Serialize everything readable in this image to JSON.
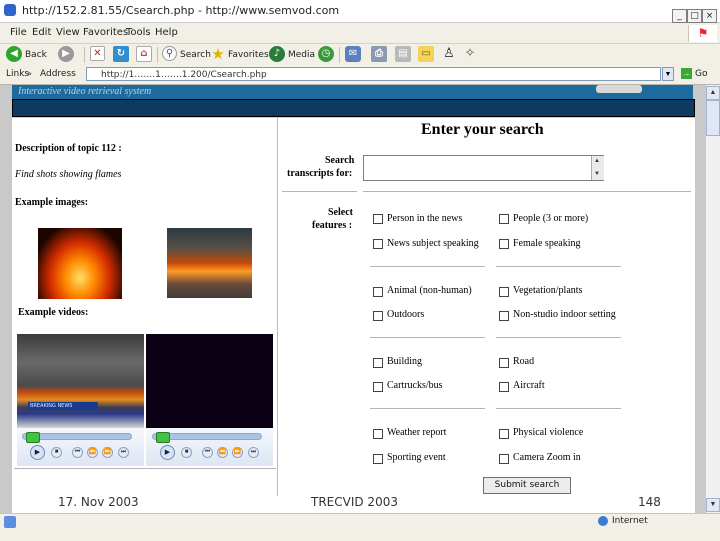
{
  "window": {
    "title": "http://152.2.81.55/Csearch.php - http://www.semvod.com",
    "buttons": [
      "_",
      "□",
      "×"
    ]
  },
  "menu": [
    "File",
    "Edit",
    "View",
    "Favorites",
    "Tools",
    "Help"
  ],
  "toolbar": {
    "back": "Back",
    "search": "Search",
    "favorites": "Favorites",
    "media": "Media"
  },
  "address": {
    "links_label": "Links",
    "address_label": "Address",
    "url": "http://1…….1…….1.200/Csearch.php",
    "go_label": "Go"
  },
  "page": {
    "banner_text": "Interactive video retrieval system",
    "left": {
      "description_heading": "Description of topic 112 :",
      "topic_text": "Find shots showing flames",
      "example_images_label": "Example images:",
      "example_videos_label": "Example videos:",
      "video_caption": "BREAKING NEWS"
    },
    "right": {
      "heading": "Enter your search",
      "search_label_line1": "Search",
      "search_label_line2": "transcripts for:",
      "features_label_line1": "Select",
      "features_label_line2": "features :",
      "feature_groups": [
        [
          "Person in the news",
          "People (3 or more)",
          "News subject speaking",
          "Female speaking"
        ],
        [
          "Animal (non-human)",
          "Vegetation/plants",
          "Outdoors",
          "Non-studio indoor setting"
        ],
        [
          "Building",
          "Road",
          "Cartrucks/bus",
          "Aircraft"
        ],
        [
          "Weather report",
          "Physical violence",
          "Sporting event",
          "Camera Zoom in"
        ]
      ],
      "submit_label": "Submit search"
    }
  },
  "slide_footer": {
    "date": "17. Nov 2003",
    "center": "TRECVID 2003",
    "page_number": "148"
  },
  "status": {
    "zone": "Internet"
  }
}
